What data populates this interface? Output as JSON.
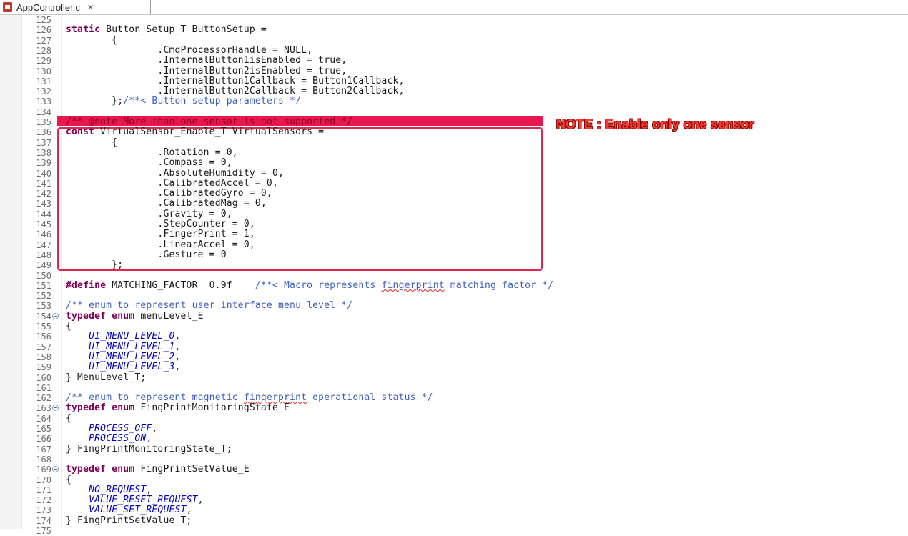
{
  "tab": {
    "label": "AppController.c",
    "close_glyph": "✕",
    "icon": "c-file-icon"
  },
  "note": "NOTE : Enable only one sensor",
  "colors": {
    "highlight": "#e8174e",
    "box": "#e0284f",
    "note": "#ff3b30",
    "keyword": "#7f0055",
    "comment": "#3f5fbf",
    "enum": "#0000c0"
  },
  "lines": [
    {
      "n": "125",
      "t": ""
    },
    {
      "n": "126",
      "t": "static Button_Setup_T ButtonSetup ="
    },
    {
      "n": "127",
      "t": "        {"
    },
    {
      "n": "128",
      "t": "                .CmdProcessorHandle = NULL,"
    },
    {
      "n": "129",
      "t": "                .InternalButton1isEnabled = true,"
    },
    {
      "n": "130",
      "t": "                .InternalButton2isEnabled = true,"
    },
    {
      "n": "131",
      "t": "                .InternalButton1Callback = Button1Callback,"
    },
    {
      "n": "132",
      "t": "                .InternalButton2Callback = Button2Callback,"
    },
    {
      "n": "133",
      "t": "        };/**< Button setup parameters */"
    },
    {
      "n": "134",
      "t": ""
    },
    {
      "n": "135",
      "t": "/** @note More than one sensor is not supported */"
    },
    {
      "n": "136",
      "t": "const VirtualSensor_Enable_T VirtualSensors ="
    },
    {
      "n": "137",
      "t": "        {"
    },
    {
      "n": "138",
      "t": "                .Rotation = 0,"
    },
    {
      "n": "139",
      "t": "                .Compass = 0,"
    },
    {
      "n": "140",
      "t": "                .AbsoluteHumidity = 0,"
    },
    {
      "n": "141",
      "t": "                .CalibratedAccel = 0,"
    },
    {
      "n": "142",
      "t": "                .CalibratedGyro = 0,"
    },
    {
      "n": "143",
      "t": "                .CalibratedMag = 0,"
    },
    {
      "n": "144",
      "t": "                .Gravity = 0,"
    },
    {
      "n": "145",
      "t": "                .StepCounter = 0,"
    },
    {
      "n": "146",
      "t": "                .FingerPrint = 1,"
    },
    {
      "n": "147",
      "t": "                .LinearAccel = 0,"
    },
    {
      "n": "148",
      "t": "                .Gesture = 0"
    },
    {
      "n": "149",
      "t": "        };"
    },
    {
      "n": "150",
      "t": ""
    },
    {
      "n": "151",
      "t": "#define MATCHING_FACTOR  0.9f    /**< Macro represents fingerprint matching factor */"
    },
    {
      "n": "152",
      "t": ""
    },
    {
      "n": "153",
      "t": "/** enum to represent user interface menu level */"
    },
    {
      "n": "154",
      "t": "typedef enum menuLevel_E",
      "fold": true
    },
    {
      "n": "155",
      "t": "{"
    },
    {
      "n": "156",
      "t": "    UI_MENU_LEVEL_0,"
    },
    {
      "n": "157",
      "t": "    UI_MENU_LEVEL_1,"
    },
    {
      "n": "158",
      "t": "    UI_MENU_LEVEL_2,"
    },
    {
      "n": "159",
      "t": "    UI_MENU_LEVEL_3,"
    },
    {
      "n": "160",
      "t": "} MenuLevel_T;"
    },
    {
      "n": "161",
      "t": ""
    },
    {
      "n": "162",
      "t": "/** enum to represent magnetic fingerprint operational status */"
    },
    {
      "n": "163",
      "t": "typedef enum FingPrintMonitoringState_E",
      "fold": true
    },
    {
      "n": "164",
      "t": "{"
    },
    {
      "n": "165",
      "t": "    PROCESS_OFF,"
    },
    {
      "n": "166",
      "t": "    PROCESS_ON,"
    },
    {
      "n": "167",
      "t": "} FingPrintMonitoringState_T;"
    },
    {
      "n": "168",
      "t": ""
    },
    {
      "n": "169",
      "t": "typedef enum FingPrintSetValue_E",
      "fold": true
    },
    {
      "n": "170",
      "t": "{"
    },
    {
      "n": "171",
      "t": "    NO_REQUEST,"
    },
    {
      "n": "172",
      "t": "    VALUE_RESET_REQUEST,"
    },
    {
      "n": "173",
      "t": "    VALUE_SET_REQUEST,"
    },
    {
      "n": "174",
      "t": "} FingPrintSetValue_T;"
    },
    {
      "n": "175",
      "t": ""
    }
  ]
}
